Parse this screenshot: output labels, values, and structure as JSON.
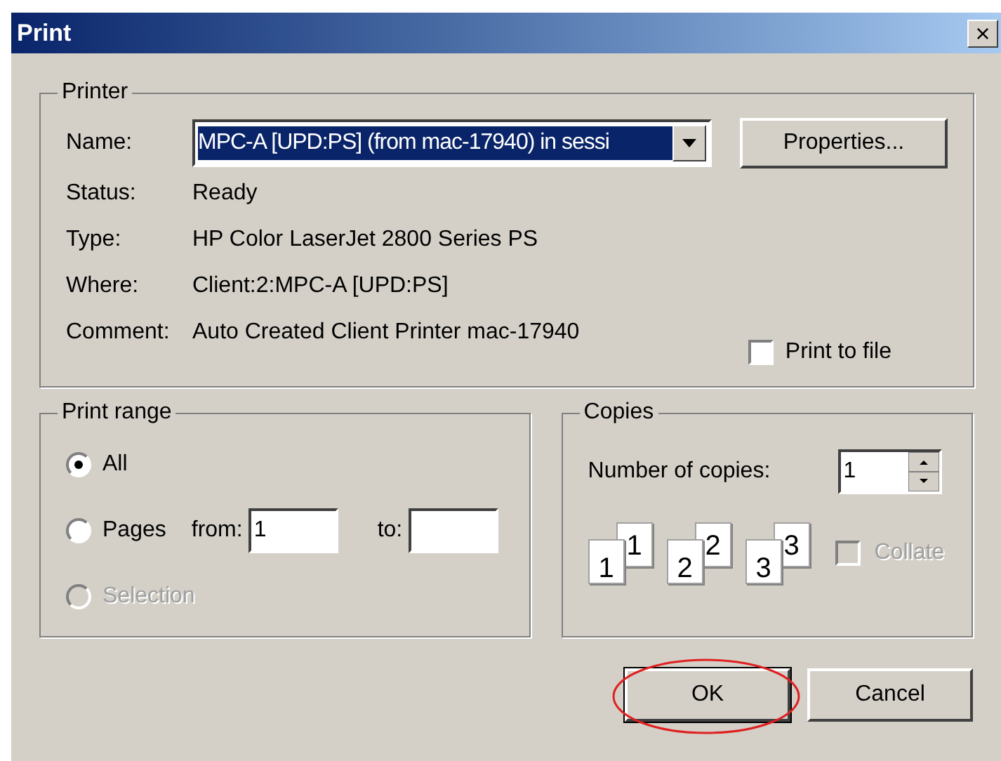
{
  "window": {
    "title": "Print",
    "close": "×"
  },
  "printer": {
    "legend": "Printer",
    "name_label": "Name:",
    "name_value": "MPC-A [UPD:PS] (from mac-17940) in sessi",
    "properties": "Properties...",
    "info": [
      {
        "label": "Status:",
        "value": "Ready"
      },
      {
        "label": "Type:",
        "value": "HP Color LaserJet 2800 Series PS"
      },
      {
        "label": "Where:",
        "value": "Client:2:MPC-A [UPD:PS]"
      },
      {
        "label": "Comment:",
        "value": "Auto Created Client Printer mac-17940"
      }
    ],
    "print_to_file": {
      "label": "Print to file",
      "checked": false
    }
  },
  "print_range": {
    "legend": "Print range",
    "options": [
      {
        "label": "All",
        "selected": true,
        "disabled": false
      },
      {
        "label": "Pages",
        "selected": false,
        "disabled": false
      },
      {
        "label": "Selection",
        "selected": false,
        "disabled": true
      }
    ],
    "from_label": "from:",
    "from_value": "1",
    "to_label": "to:"
  },
  "copies": {
    "legend": "Copies",
    "number_label": "Number of copies:",
    "number_value": "1",
    "collate_pages": [
      [
        "1",
        "1"
      ],
      [
        "2",
        "2"
      ],
      [
        "3",
        "3"
      ]
    ],
    "collate": {
      "label": "Collate",
      "checked": false,
      "disabled": true
    }
  },
  "buttons": [
    {
      "label": "OK",
      "highlighted": true
    },
    {
      "label": "Cancel",
      "highlighted": false
    }
  ]
}
